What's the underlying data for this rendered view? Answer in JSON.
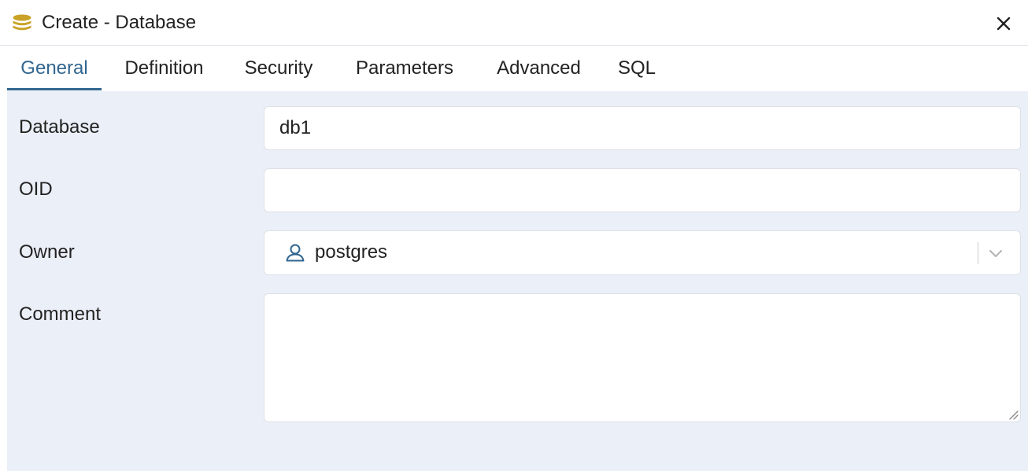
{
  "dialog": {
    "title": "Create - Database",
    "title_icon": "database-icon",
    "close_icon": "close-icon"
  },
  "tabs": [
    {
      "label": "General",
      "active": true
    },
    {
      "label": "Definition",
      "active": false
    },
    {
      "label": "Security",
      "active": false
    },
    {
      "label": "Parameters",
      "active": false
    },
    {
      "label": "Advanced",
      "active": false
    },
    {
      "label": "SQL",
      "active": false
    }
  ],
  "form": {
    "database": {
      "label": "Database",
      "value": "db1"
    },
    "oid": {
      "label": "OID",
      "value": ""
    },
    "owner": {
      "label": "Owner",
      "value": "postgres",
      "icon": "user-icon",
      "dropdown_icon": "chevron-down-icon"
    },
    "comment": {
      "label": "Comment",
      "value": ""
    }
  },
  "colors": {
    "accent": "#326690",
    "panel_background": "#ebeff7",
    "title_icon": "#c9a227"
  }
}
